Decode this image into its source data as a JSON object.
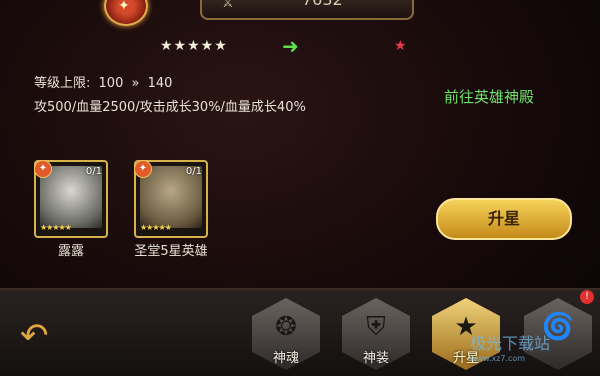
{
  "header": {
    "power_value": "7632",
    "power_icon": "crossed-swords-icon",
    "emblem_icon": "emblem-icon"
  },
  "star_upgrade": {
    "current_stars": "★★★★★",
    "target_star": "★",
    "arrow": "➜"
  },
  "level": {
    "label": "等级上限:",
    "from": "100",
    "arrows": "»",
    "to": "140"
  },
  "stats": "攻500/血量2500/攻击成长30%/血量成长40%",
  "hall_link": "前往英雄神殿",
  "materials": [
    {
      "name": "露露",
      "count": "0/1"
    },
    {
      "name": "圣堂5星英雄",
      "count": "0/1"
    }
  ],
  "upgrade_button": "升星",
  "tabs": [
    {
      "label": "神魂",
      "icon": "soul-icon"
    },
    {
      "label": "神装",
      "icon": "armor-icon"
    },
    {
      "label": "升星",
      "icon": "star-icon"
    },
    {
      "label": "",
      "icon": "swirl-icon"
    }
  ],
  "badge": "!",
  "watermark": {
    "main": "极光下载站",
    "sub": "www.xz7.com"
  }
}
